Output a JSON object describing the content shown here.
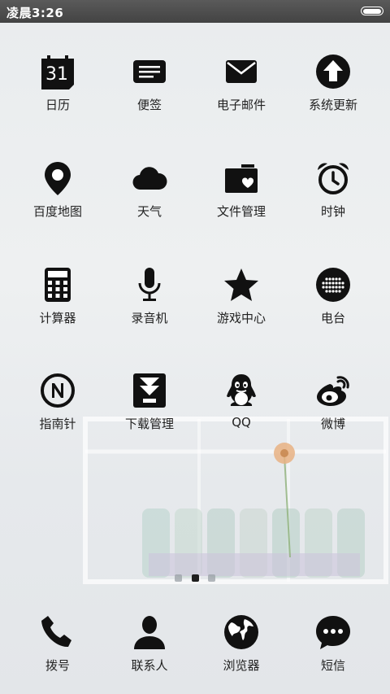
{
  "status_bar": {
    "time": "凌晨3:26"
  },
  "grid": [
    {
      "name": "calendar",
      "label": "日历",
      "badge": "31"
    },
    {
      "name": "notes",
      "label": "便签"
    },
    {
      "name": "email",
      "label": "电子邮件"
    },
    {
      "name": "system-update",
      "label": "系统更新"
    },
    {
      "name": "maps",
      "label": "百度地图"
    },
    {
      "name": "weather",
      "label": "天气"
    },
    {
      "name": "file-manager",
      "label": "文件管理"
    },
    {
      "name": "clock",
      "label": "时钟"
    },
    {
      "name": "calculator",
      "label": "计算器"
    },
    {
      "name": "recorder",
      "label": "录音机"
    },
    {
      "name": "game-center",
      "label": "游戏中心"
    },
    {
      "name": "radio",
      "label": "电台"
    },
    {
      "name": "compass",
      "label": "指南针"
    },
    {
      "name": "downloads",
      "label": "下载管理"
    },
    {
      "name": "qq",
      "label": "QQ"
    },
    {
      "name": "weibo",
      "label": "微博"
    }
  ],
  "page_indicator": {
    "count": 3,
    "active": 2
  },
  "dock": [
    {
      "name": "phone",
      "label": "拨号"
    },
    {
      "name": "contacts",
      "label": "联系人"
    },
    {
      "name": "browser",
      "label": "浏览器"
    },
    {
      "name": "messages",
      "label": "短信"
    }
  ],
  "colors": {
    "icon": "#111111",
    "label": "#222222",
    "status_bar": "#4a4a4a"
  }
}
